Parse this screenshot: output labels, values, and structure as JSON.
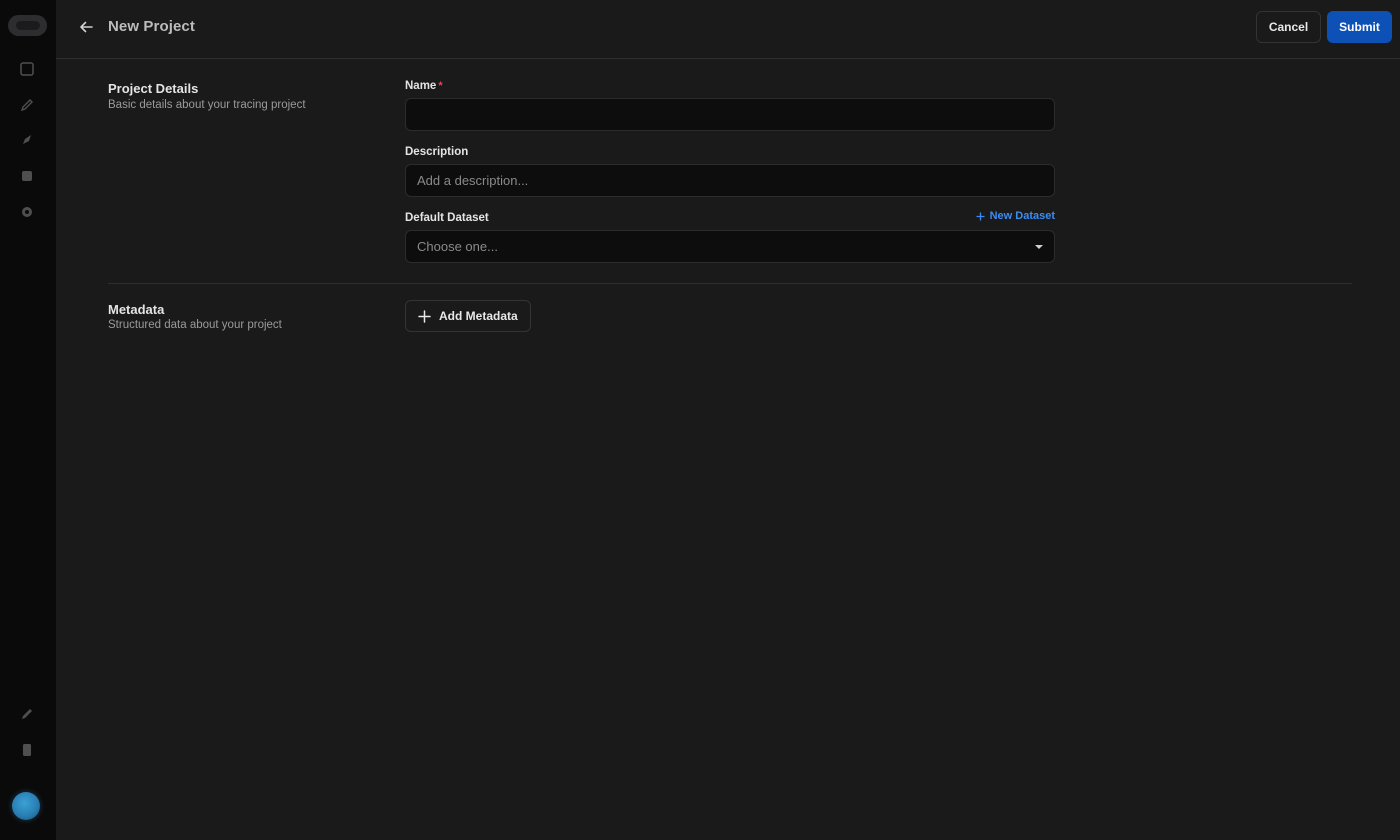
{
  "header": {
    "title": "New Project",
    "cancel_label": "Cancel",
    "submit_label": "Submit"
  },
  "project_details": {
    "title": "Project Details",
    "subtitle": "Basic details about your tracing project"
  },
  "fields": {
    "name": {
      "label": "Name",
      "required_mark": "*",
      "value": "",
      "placeholder": ""
    },
    "description": {
      "label": "Description",
      "value": "",
      "placeholder": "Add a description..."
    },
    "default_dataset": {
      "label": "Default Dataset",
      "placeholder": "Choose one...",
      "new_dataset_label": "New Dataset"
    }
  },
  "metadata": {
    "title": "Metadata",
    "subtitle": "Structured data about your project",
    "add_label": "Add Metadata"
  },
  "colors": {
    "accent": "#0d50b6",
    "link": "#3d8bf0",
    "required": "#e5484d",
    "background": "#1a1a1a",
    "input_background": "#0d0d0e"
  },
  "icons": {
    "back": "arrow-left-icon",
    "add": "plus-icon",
    "caret": "chevron-down-icon"
  }
}
